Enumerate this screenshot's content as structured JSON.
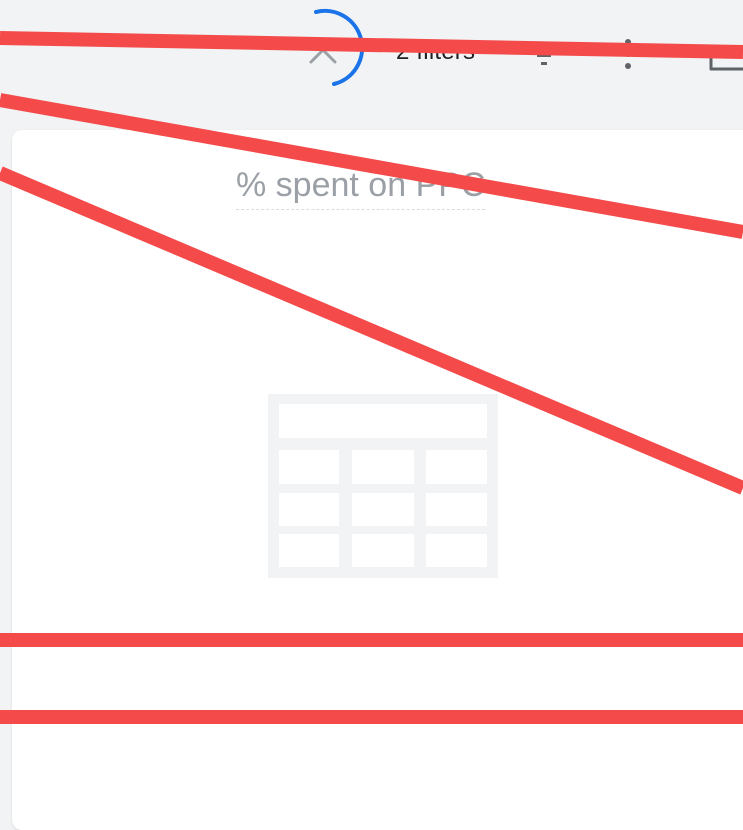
{
  "toolbar": {
    "filters_label": "2 filters",
    "icons": {
      "collapse": "chevron-up-icon",
      "loading": "loading-spinner-icon",
      "filter": "filter-icon",
      "more": "more-vert-icon",
      "folder": "folder-icon"
    }
  },
  "card": {
    "title": "% spent on PPC",
    "placeholder_icon": "table-icon"
  },
  "colors": {
    "page_background": "#f1f3f4",
    "spinner": "#1a73e8",
    "annotation_red": "#f44a4a",
    "placeholder_grey": "#f1f3f4"
  }
}
